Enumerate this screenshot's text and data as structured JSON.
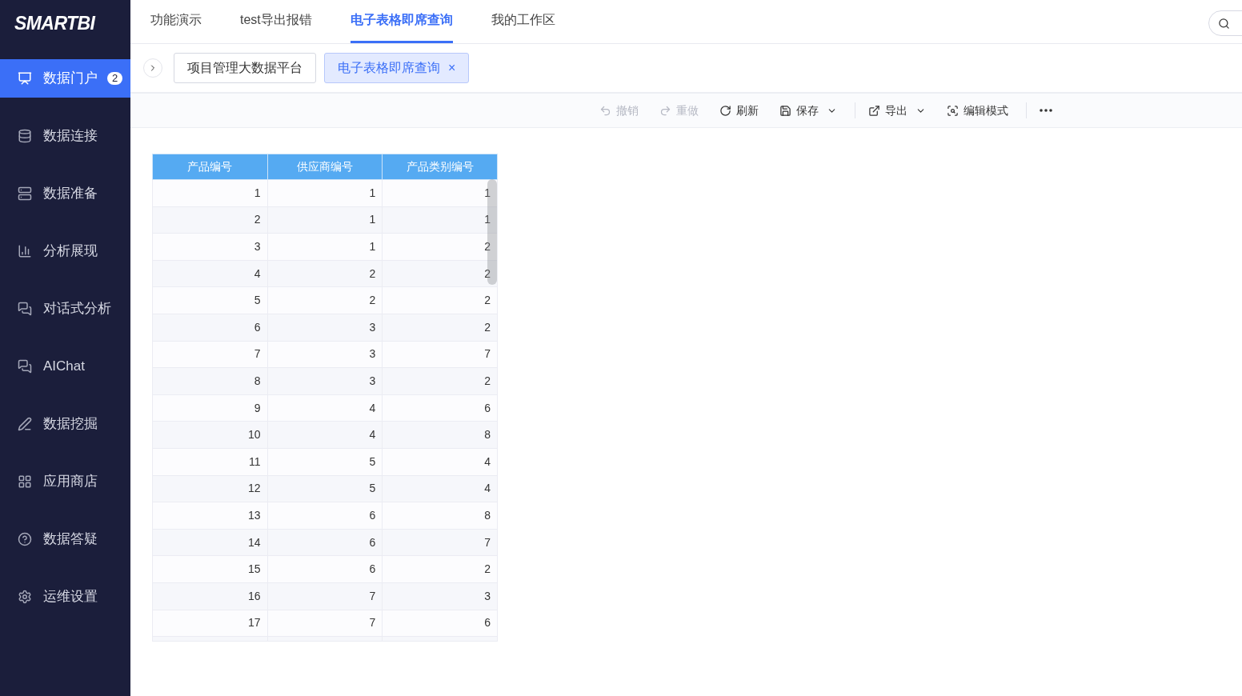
{
  "logo": "SMARTBI",
  "sidebar": {
    "items": [
      {
        "label": "数据门户",
        "selected": true,
        "badge": "2"
      },
      {
        "label": "数据连接",
        "selected": false
      },
      {
        "label": "数据准备",
        "selected": false
      },
      {
        "label": "分析展现",
        "selected": false
      },
      {
        "label": "对话式分析",
        "selected": false
      },
      {
        "label": "AIChat",
        "selected": false
      },
      {
        "label": "数据挖掘",
        "selected": false
      },
      {
        "label": "应用商店",
        "selected": false
      },
      {
        "label": "数据答疑",
        "selected": false
      },
      {
        "label": "运维设置",
        "selected": false
      }
    ]
  },
  "top_tabs": [
    {
      "label": "功能演示",
      "selected": false
    },
    {
      "label": "test导出报错",
      "selected": false
    },
    {
      "label": "电子表格即席查询",
      "selected": true
    },
    {
      "label": "我的工作区",
      "selected": false
    }
  ],
  "page_tabs": [
    {
      "label": "项目管理大数据平台",
      "selected": false,
      "closable": false
    },
    {
      "label": "电子表格即席查询",
      "selected": true,
      "closable": true,
      "close": "×"
    }
  ],
  "toolbar": [
    {
      "label": "撤销",
      "kind": "undo",
      "disabled": true,
      "dropdown": false
    },
    {
      "label": "重做",
      "kind": "redo",
      "disabled": true,
      "dropdown": false
    },
    {
      "label": "刷新",
      "kind": "refresh",
      "disabled": false,
      "dropdown": false
    },
    {
      "label": "保存",
      "kind": "save",
      "disabled": false,
      "dropdown": true
    },
    {
      "label": "导出",
      "kind": "export",
      "disabled": false,
      "dropdown": true,
      "divider_before": true
    },
    {
      "label": "编辑模式",
      "kind": "edit",
      "disabled": false,
      "dropdown": false
    },
    {
      "kind": "more",
      "disabled": false,
      "dropdown": false,
      "divider_before": true
    }
  ],
  "table": {
    "columns": [
      "产品编号",
      "供应商编号",
      "产品类别编号"
    ],
    "rows": [
      [
        "1",
        "1",
        "1"
      ],
      [
        "2",
        "1",
        "1"
      ],
      [
        "3",
        "1",
        "2"
      ],
      [
        "4",
        "2",
        "2"
      ],
      [
        "5",
        "2",
        "2"
      ],
      [
        "6",
        "3",
        "2"
      ],
      [
        "7",
        "3",
        "7"
      ],
      [
        "8",
        "3",
        "2"
      ],
      [
        "9",
        "4",
        "6"
      ],
      [
        "10",
        "4",
        "8"
      ],
      [
        "11",
        "5",
        "4"
      ],
      [
        "12",
        "5",
        "4"
      ],
      [
        "13",
        "6",
        "8"
      ],
      [
        "14",
        "6",
        "7"
      ],
      [
        "15",
        "6",
        "2"
      ],
      [
        "16",
        "7",
        "3"
      ],
      [
        "17",
        "7",
        "6"
      ]
    ]
  }
}
